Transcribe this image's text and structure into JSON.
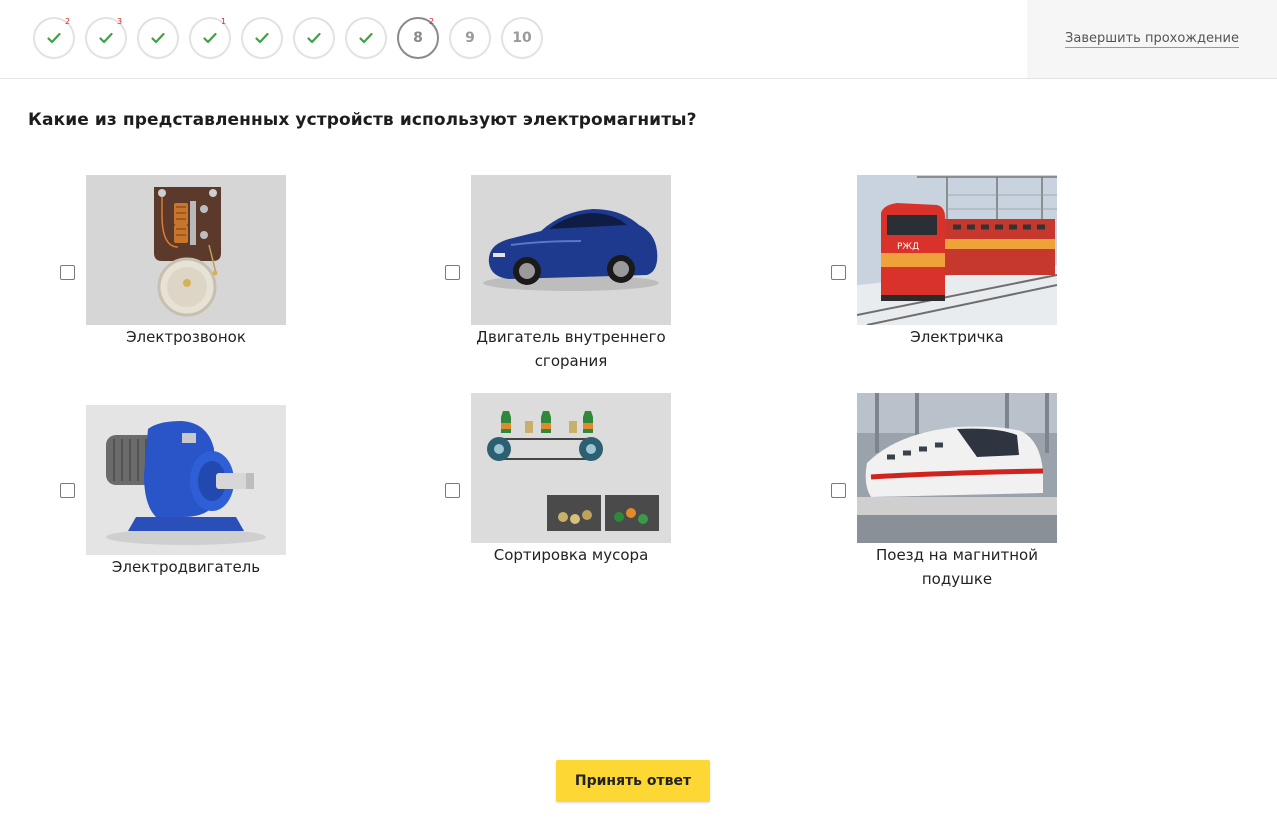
{
  "progress": {
    "steps": [
      {
        "label": "",
        "state": "done",
        "badge": "2"
      },
      {
        "label": "",
        "state": "done",
        "badge": "3"
      },
      {
        "label": "",
        "state": "done",
        "badge": ""
      },
      {
        "label": "",
        "state": "done",
        "badge": "1"
      },
      {
        "label": "",
        "state": "done",
        "badge": ""
      },
      {
        "label": "",
        "state": "done",
        "badge": ""
      },
      {
        "label": "",
        "state": "done",
        "badge": ""
      },
      {
        "label": "8",
        "state": "current",
        "badge": "2"
      },
      {
        "label": "9",
        "state": "todo",
        "badge": ""
      },
      {
        "label": "10",
        "state": "todo",
        "badge": ""
      }
    ],
    "check_color": "#43a047",
    "badge_color": "#d9262b"
  },
  "header": {
    "finish_label": "Завершить прохождение"
  },
  "question": {
    "text": "Какие из представленных устройств используют электромагниты?"
  },
  "options": [
    {
      "caption": "Электрозвонок",
      "image": "electric-bell-image"
    },
    {
      "caption": "Двигатель внутреннего сгорания",
      "image": "blue-sports-car-image"
    },
    {
      "caption": "Электричка",
      "image": "red-electric-train-image"
    },
    {
      "caption": "Электродвигатель",
      "image": "blue-electric-motor-image"
    },
    {
      "caption": "Сортировка мусора",
      "image": "waste-sorting-conveyor-image"
    },
    {
      "caption": "Поезд на магнитной подушке",
      "image": "maglev-train-image"
    }
  ],
  "submit": {
    "label": "Принять ответ",
    "color": "#fdd835"
  }
}
